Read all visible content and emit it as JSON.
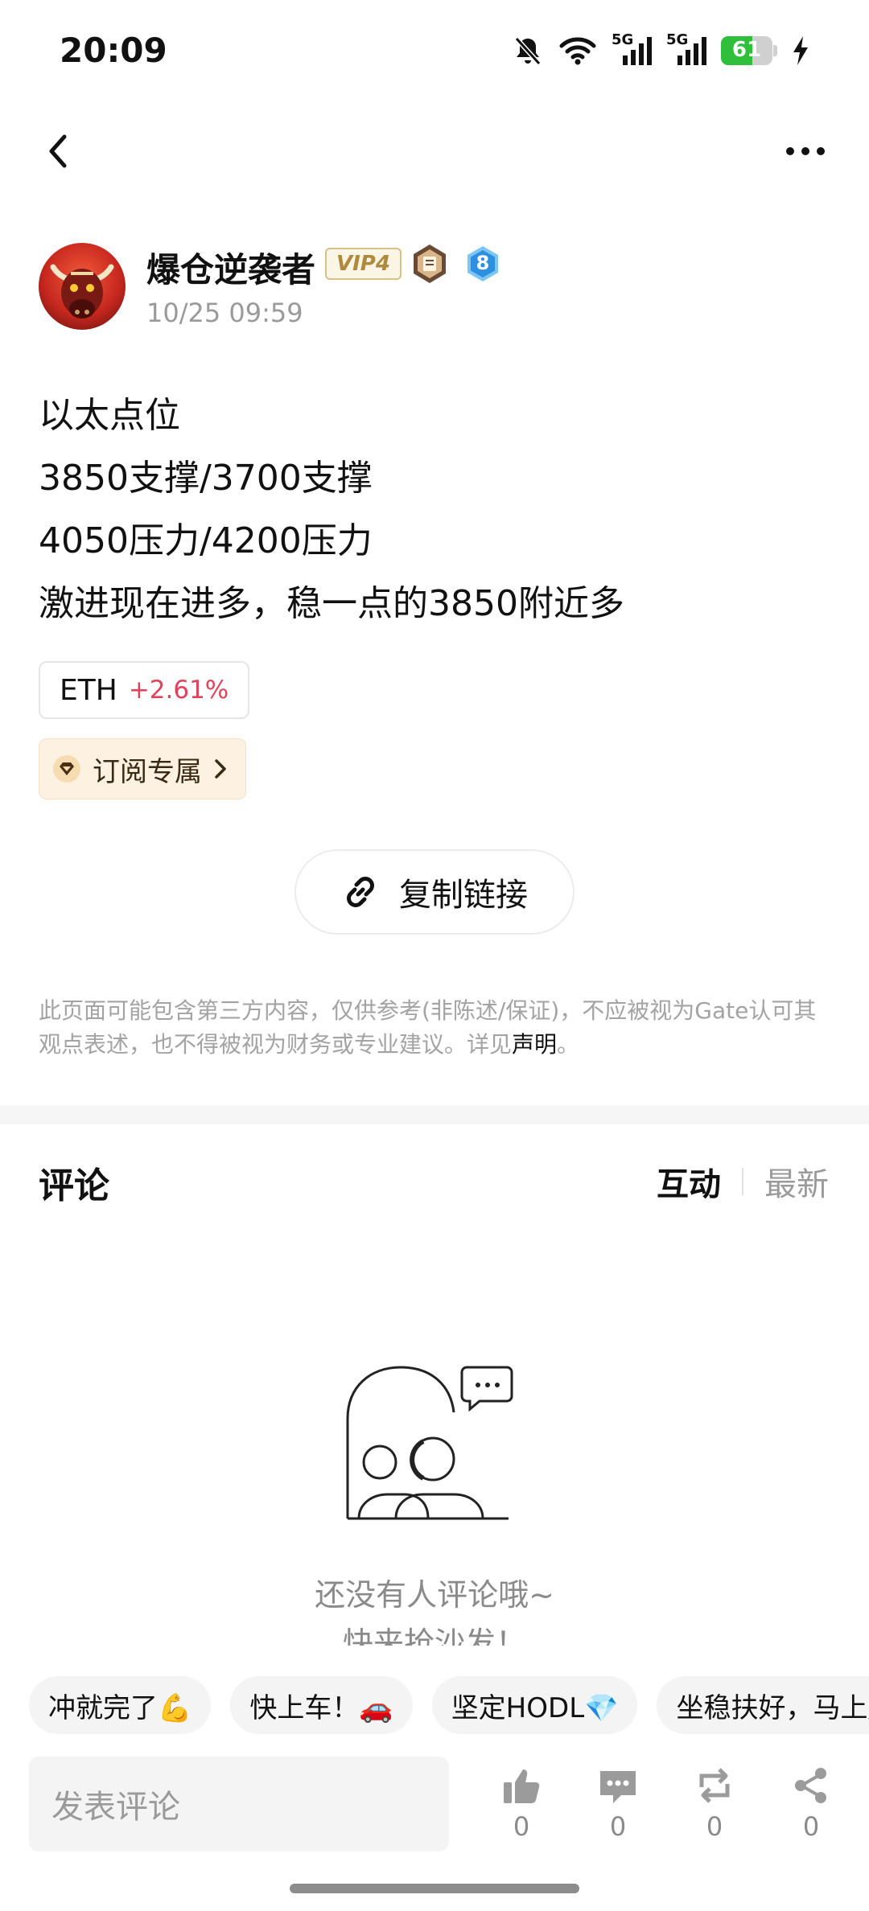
{
  "status_bar": {
    "time": "20:09",
    "network_1": "5G",
    "network_2": "5G",
    "battery_percent": "61",
    "battery_level": 0.61,
    "icons": [
      "mute-bell-icon",
      "wifi-icon",
      "signal-5g-icon",
      "signal-5g-icon",
      "battery-icon",
      "charging-icon"
    ]
  },
  "nav": {
    "back_icon": "chevron-left-icon",
    "more_icon": "more-dots-icon"
  },
  "author": {
    "name": "爆仓逆袭者",
    "vip_label": "VIP4",
    "level": "8",
    "time": "10/25 09:59"
  },
  "post": {
    "lines": [
      "以太点位",
      "3850支撑/3700支撑",
      "4050压力/4200压力",
      "激进现在进多，稳一点的3850附近多"
    ]
  },
  "ticker": {
    "symbol": "ETH",
    "change": "+2.61%",
    "change_color": "#e0435b"
  },
  "subscribe": {
    "label": "订阅专属",
    "icon": "diamond-icon"
  },
  "copy_link": {
    "label": "复制链接",
    "icon": "link-icon"
  },
  "disclaimer": {
    "text": "此页面可能包含第三方内容，仅供参考(非陈述/保证)，不应被视为Gate认可其观点表述，也不得被视为财务或专业建议。详见",
    "link": "声明",
    "end": "。"
  },
  "comments": {
    "title": "评论",
    "tabs": [
      {
        "label": "互动",
        "active": true
      },
      {
        "label": "最新",
        "active": false
      }
    ],
    "empty_title": "还没有人评论哦~",
    "empty_sub": "快来抢沙发！"
  },
  "quick_replies": [
    "冲就完了💪",
    "快上车！🚗",
    "坚定HODL💎",
    "坐稳扶好，马上起飞"
  ],
  "bottom_bar": {
    "input_placeholder": "发表评论",
    "like_count": "0",
    "comment_count": "0",
    "repost_count": "0",
    "share_count": "0"
  },
  "colors": {
    "accent_red": "#e0435b",
    "battery_green": "#2fbf3b",
    "subscribe_bg": "#fdf2e1"
  }
}
